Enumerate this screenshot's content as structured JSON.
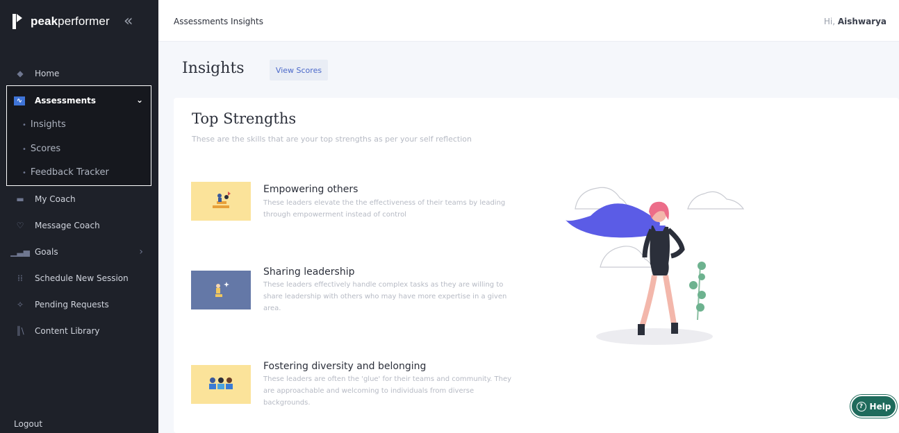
{
  "brand": {
    "name_bold": "peak",
    "name_rest": "performer",
    "collapse_glyph": "«"
  },
  "sidebar": {
    "items": [
      {
        "label": "Home",
        "icon": "diamond-icon"
      },
      {
        "label": "My Coach",
        "icon": "coach-icon"
      },
      {
        "label": "Message Coach",
        "icon": "chat-icon"
      },
      {
        "label": "Goals",
        "icon": "bar-chart-icon",
        "chevron": "›"
      },
      {
        "label": "Schedule New Session",
        "icon": "calendar-icon"
      },
      {
        "label": "Pending Requests",
        "icon": "requests-icon"
      },
      {
        "label": "Content Library",
        "icon": "library-icon"
      }
    ],
    "assessments": {
      "label": "Assessments",
      "chevron": "⌄",
      "sub_items": [
        {
          "label": "Insights"
        },
        {
          "label": "Scores"
        },
        {
          "label": "Feedback Tracker"
        }
      ]
    },
    "logout": "Logout"
  },
  "topbar": {
    "breadcrumb": "Assessments Insights",
    "greeting_prefix": "Hi, ",
    "user_name": "Aishwarya"
  },
  "page": {
    "title": "Insights",
    "view_scores": "View Scores"
  },
  "card": {
    "title": "Top Strengths",
    "subtitle": "These are the skills that are your top strengths as per your self reflection",
    "strengths": [
      {
        "title": "Empowering others",
        "description": "These leaders elevate the the effectiveness of their teams by leading through empowerment instead of control"
      },
      {
        "title": "Sharing leadership",
        "description": "These leaders effectively handle complex tasks as they are willing to share leadership with others who may have more expertise in a given area."
      },
      {
        "title": "Fostering diversity and belonging",
        "description": "These leaders are often the 'glue' for their teams and community. They are approachable and welcoming to individuals from diverse backgrounds."
      }
    ]
  },
  "help": {
    "label": "Help",
    "icon_glyph": "?"
  },
  "colors": {
    "sidebar_bg": "#1e2129",
    "accent_blue": "#3f74d8",
    "help_green": "#1f6b5c",
    "cape": "#5b5ce6",
    "hair": "#ec6d89"
  }
}
